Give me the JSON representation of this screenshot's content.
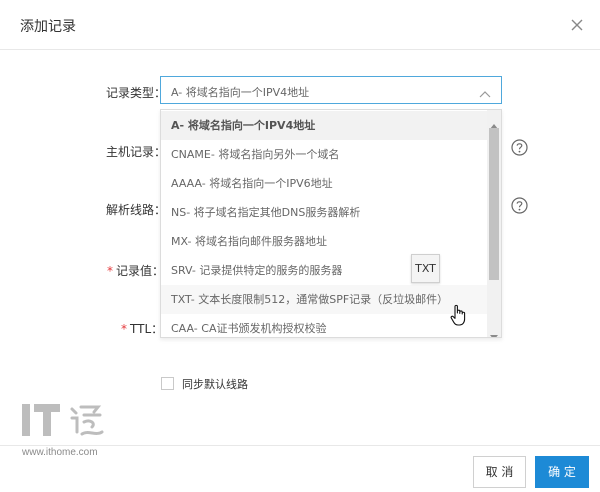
{
  "dialog": {
    "title": "添加记录",
    "close_icon": "close-icon"
  },
  "form": {
    "record_type": {
      "label": "记录类型：",
      "value": "A- 将域名指向一个IPV4地址",
      "icon": "chevron-up-icon"
    },
    "host_record": {
      "label": "主机记录：",
      "help_icon": "question-circle-icon"
    },
    "resolve_line": {
      "label": "解析线路：",
      "help_icon": "question-circle-icon"
    },
    "record_value": {
      "required_mark": "*",
      "label": "记录值："
    },
    "ttl": {
      "required_mark": "*",
      "label": "TTL："
    },
    "sync_default": {
      "label": "同步默认线路",
      "checked": false
    }
  },
  "dropdown": {
    "options": [
      "A- 将域名指向一个IPV4地址",
      "CNAME- 将域名指向另外一个域名",
      "AAAA- 将域名指向一个IPV6地址",
      "NS- 将子域名指定其他DNS服务器解析",
      "MX- 将域名指向邮件服务器地址",
      "SRV- 记录提供特定的服务的服务器",
      "TXT- 文本长度限制512，通常做SPF记录（反垃圾邮件）",
      "CAA- CA证书颁发机构授权校验"
    ],
    "selected_index": 0,
    "hover_index": 6,
    "tooltip": "TXT"
  },
  "footer": {
    "cancel_label": "取 消",
    "ok_label": "确 定",
    "ok_color": "#1d8ad6"
  },
  "watermark": {
    "url": "www.ithome.com"
  }
}
